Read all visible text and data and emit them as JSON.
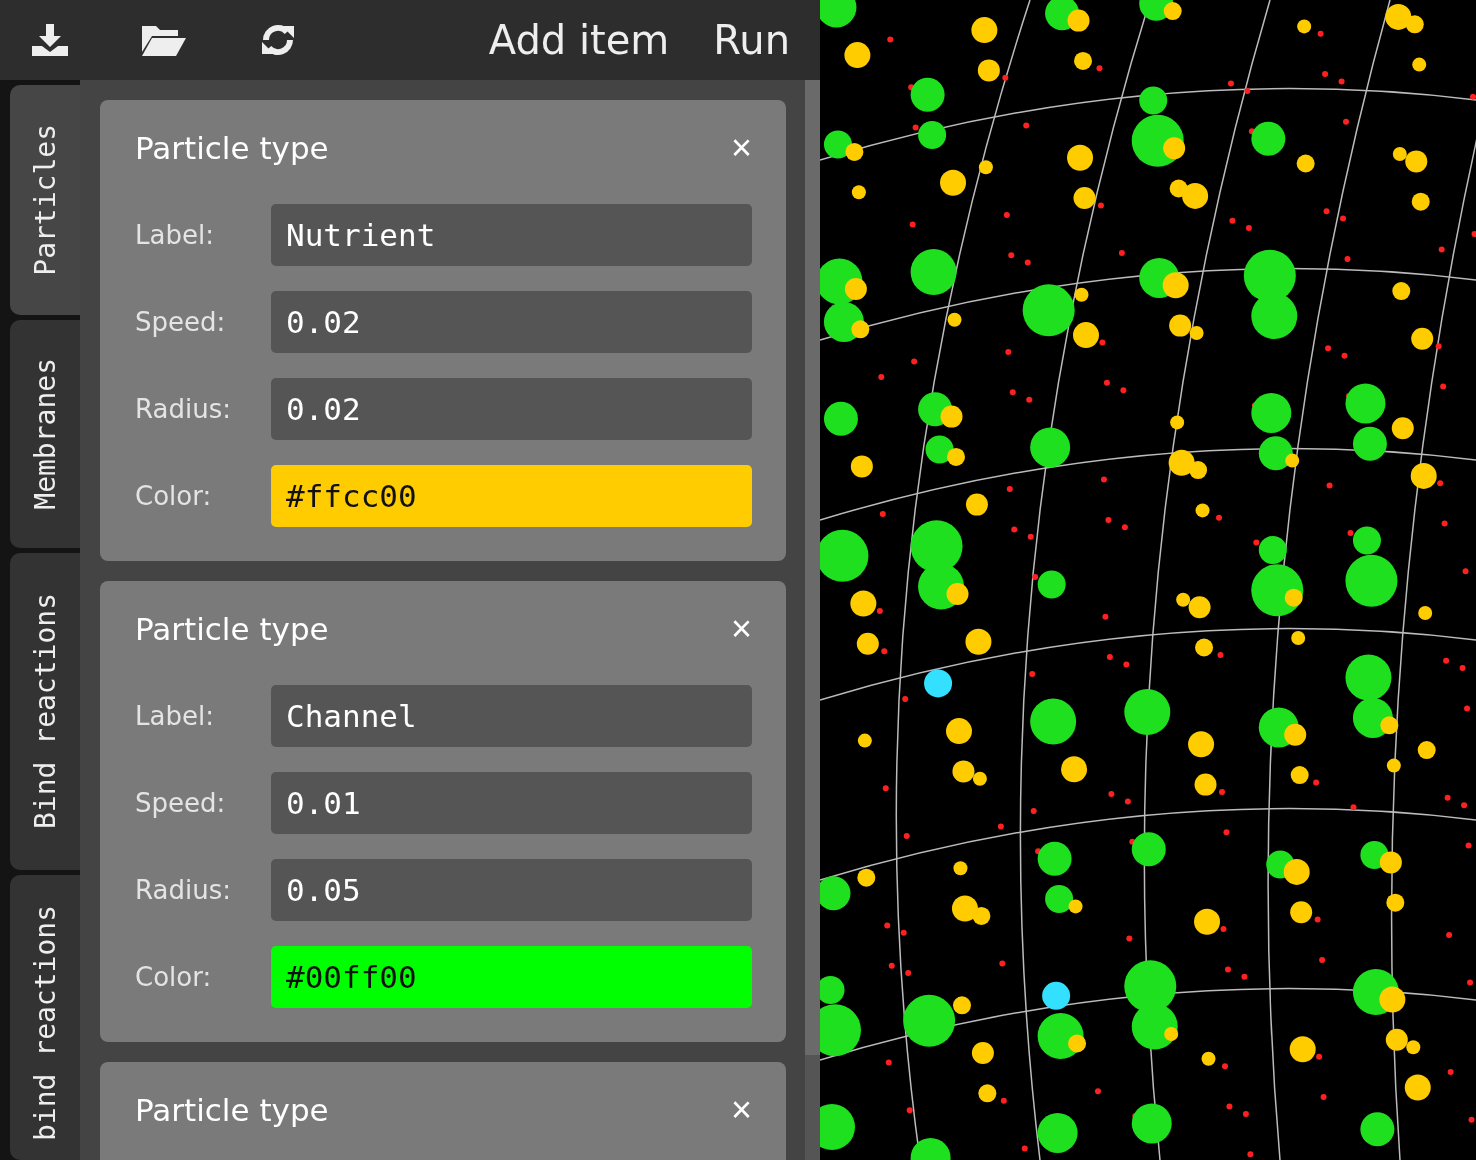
{
  "toolbar": {
    "buttons": [
      "Add item",
      "Run"
    ]
  },
  "tabs": [
    {
      "label": "Particles",
      "selected": true
    },
    {
      "label": "Membranes",
      "selected": false
    },
    {
      "label": "Bind reactions",
      "selected": false
    },
    {
      "label": "bind reactions",
      "selected": false
    }
  ],
  "cards": [
    {
      "title": "Particle type",
      "close": "×",
      "fields": [
        {
          "kind": "text",
          "label": "Label:",
          "value": "Nutrient"
        },
        {
          "kind": "text",
          "label": "Speed:",
          "value": "0.02"
        },
        {
          "kind": "text",
          "label": "Radius:",
          "value": "0.02"
        },
        {
          "kind": "color",
          "label": "Color:",
          "value": "#ffcc00",
          "color": "#ffcc00"
        }
      ]
    },
    {
      "title": "Particle type",
      "close": "×",
      "fields": [
        {
          "kind": "text",
          "label": "Label:",
          "value": "Channel"
        },
        {
          "kind": "text",
          "label": "Speed:",
          "value": "0.01"
        },
        {
          "kind": "text",
          "label": "Radius:",
          "value": "0.05"
        },
        {
          "kind": "color",
          "label": "Color:",
          "value": "#00ff00",
          "color": "#00ff00"
        }
      ]
    },
    {
      "title": "Particle type",
      "close": "×"
    }
  ]
}
